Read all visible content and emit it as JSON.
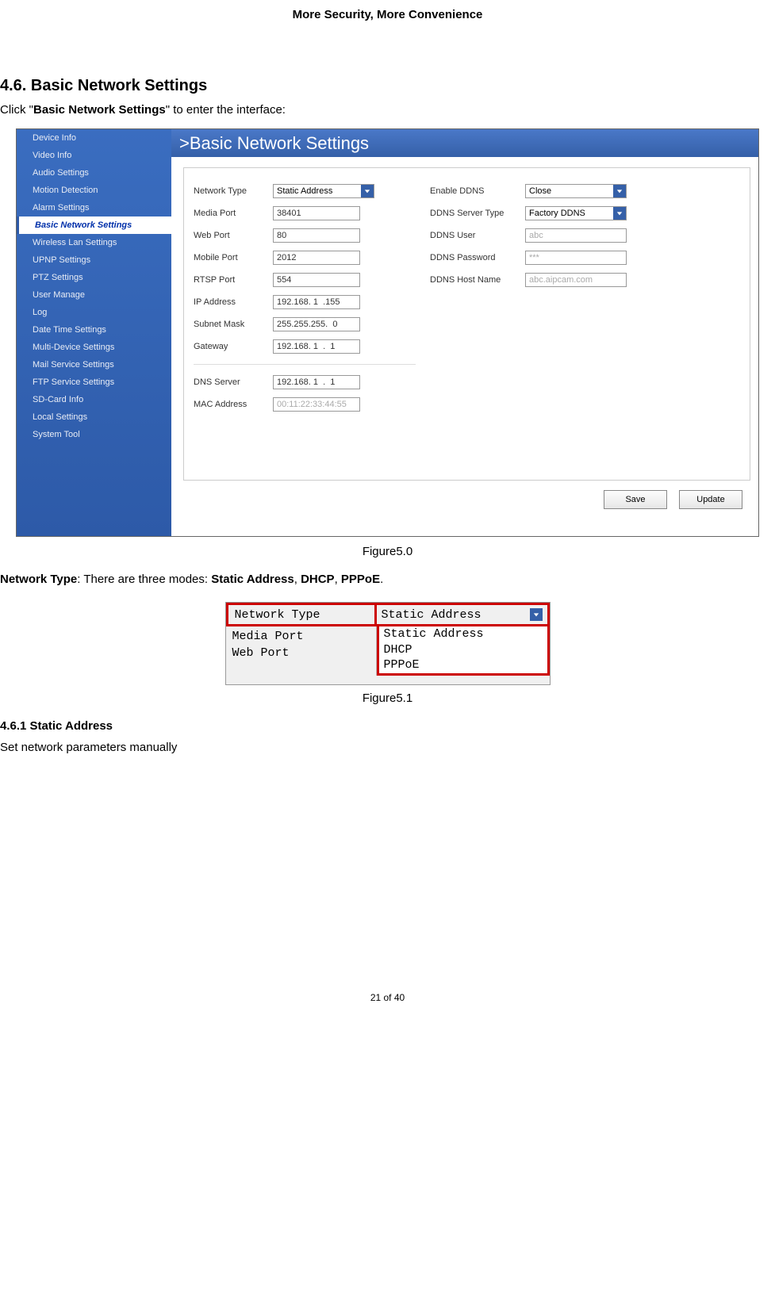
{
  "header": "More Security, More Convenience",
  "section_title": "4.6. Basic Network Settings",
  "intro_prefix": "Click \"",
  "intro_bold": "Basic Network Settings",
  "intro_suffix": "\" to enter the interface:",
  "titlebar_prefix": ">",
  "titlebar_text": "Basic Network Settings",
  "sidebar": {
    "items": [
      "Device Info",
      "Video Info",
      "Audio Settings",
      "Motion Detection",
      "Alarm Settings",
      "Basic Network Settings",
      "Wireless Lan Settings",
      "UPNP Settings",
      "PTZ Settings",
      "User Manage",
      "Log",
      "Date Time Settings",
      "Multi-Device Settings",
      "Mail Service Settings",
      "FTP Service Settings",
      "SD-Card Info",
      "Local Settings",
      "System Tool"
    ],
    "active_index": 5
  },
  "left_fields": {
    "network_type": {
      "label": "Network Type",
      "value": "Static Address"
    },
    "media_port": {
      "label": "Media Port",
      "value": "38401"
    },
    "web_port": {
      "label": "Web Port",
      "value": "80"
    },
    "mobile_port": {
      "label": "Mobile Port",
      "value": "2012"
    },
    "rtsp_port": {
      "label": "RTSP Port",
      "value": "554"
    },
    "ip_address": {
      "label": "IP Address",
      "value": "192.168. 1  .155"
    },
    "subnet_mask": {
      "label": "Subnet Mask",
      "value": "255.255.255.  0"
    },
    "gateway": {
      "label": "Gateway",
      "value": "192.168. 1  .  1"
    },
    "dns_server": {
      "label": "DNS Server",
      "value": "192.168. 1  .  1"
    },
    "mac_address": {
      "label": "MAC Address",
      "value": "00:11:22:33:44:55"
    }
  },
  "right_fields": {
    "enable_ddns": {
      "label": "Enable DDNS",
      "value": "Close"
    },
    "ddns_server_type": {
      "label": "DDNS Server Type",
      "value": "Factory DDNS"
    },
    "ddns_user": {
      "label": "DDNS User",
      "value": "abc"
    },
    "ddns_password": {
      "label": "DDNS Password",
      "value": "***"
    },
    "ddns_host_name": {
      "label": "DDNS Host Name",
      "value": "abc.aipcam.com"
    }
  },
  "buttons": {
    "save": "Save",
    "update": "Update"
  },
  "caption1": "Figure5.0",
  "body_text": {
    "prefix_bold": "Network Type",
    "mid": ": There are three modes: ",
    "m1": "Static Address",
    "c1": ", ",
    "m2": "DHCP",
    "c2": ", ",
    "m3": "PPPoE",
    "suffix": "."
  },
  "figure2": {
    "network_type_label": "Network Type",
    "network_type_value": "Static Address",
    "media_port_label": "Media Port",
    "web_port_label": "Web Port",
    "options": [
      "Static Address",
      "DHCP",
      "PPPoE"
    ]
  },
  "caption2": "Figure5.1",
  "sub_title": "4.6.1 Static Address",
  "sub_text": "Set network parameters manually",
  "footer": "21 of 40"
}
